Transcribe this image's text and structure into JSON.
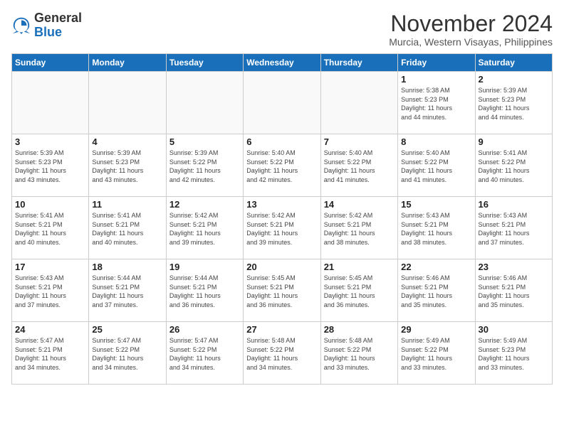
{
  "header": {
    "logo_general": "General",
    "logo_blue": "Blue",
    "month_title": "November 2024",
    "subtitle": "Murcia, Western Visayas, Philippines"
  },
  "weekdays": [
    "Sunday",
    "Monday",
    "Tuesday",
    "Wednesday",
    "Thursday",
    "Friday",
    "Saturday"
  ],
  "weeks": [
    [
      {
        "day": "",
        "info": ""
      },
      {
        "day": "",
        "info": ""
      },
      {
        "day": "",
        "info": ""
      },
      {
        "day": "",
        "info": ""
      },
      {
        "day": "",
        "info": ""
      },
      {
        "day": "1",
        "info": "Sunrise: 5:38 AM\nSunset: 5:23 PM\nDaylight: 11 hours\nand 44 minutes."
      },
      {
        "day": "2",
        "info": "Sunrise: 5:39 AM\nSunset: 5:23 PM\nDaylight: 11 hours\nand 44 minutes."
      }
    ],
    [
      {
        "day": "3",
        "info": "Sunrise: 5:39 AM\nSunset: 5:23 PM\nDaylight: 11 hours\nand 43 minutes."
      },
      {
        "day": "4",
        "info": "Sunrise: 5:39 AM\nSunset: 5:23 PM\nDaylight: 11 hours\nand 43 minutes."
      },
      {
        "day": "5",
        "info": "Sunrise: 5:39 AM\nSunset: 5:22 PM\nDaylight: 11 hours\nand 42 minutes."
      },
      {
        "day": "6",
        "info": "Sunrise: 5:40 AM\nSunset: 5:22 PM\nDaylight: 11 hours\nand 42 minutes."
      },
      {
        "day": "7",
        "info": "Sunrise: 5:40 AM\nSunset: 5:22 PM\nDaylight: 11 hours\nand 41 minutes."
      },
      {
        "day": "8",
        "info": "Sunrise: 5:40 AM\nSunset: 5:22 PM\nDaylight: 11 hours\nand 41 minutes."
      },
      {
        "day": "9",
        "info": "Sunrise: 5:41 AM\nSunset: 5:22 PM\nDaylight: 11 hours\nand 40 minutes."
      }
    ],
    [
      {
        "day": "10",
        "info": "Sunrise: 5:41 AM\nSunset: 5:21 PM\nDaylight: 11 hours\nand 40 minutes."
      },
      {
        "day": "11",
        "info": "Sunrise: 5:41 AM\nSunset: 5:21 PM\nDaylight: 11 hours\nand 40 minutes."
      },
      {
        "day": "12",
        "info": "Sunrise: 5:42 AM\nSunset: 5:21 PM\nDaylight: 11 hours\nand 39 minutes."
      },
      {
        "day": "13",
        "info": "Sunrise: 5:42 AM\nSunset: 5:21 PM\nDaylight: 11 hours\nand 39 minutes."
      },
      {
        "day": "14",
        "info": "Sunrise: 5:42 AM\nSunset: 5:21 PM\nDaylight: 11 hours\nand 38 minutes."
      },
      {
        "day": "15",
        "info": "Sunrise: 5:43 AM\nSunset: 5:21 PM\nDaylight: 11 hours\nand 38 minutes."
      },
      {
        "day": "16",
        "info": "Sunrise: 5:43 AM\nSunset: 5:21 PM\nDaylight: 11 hours\nand 37 minutes."
      }
    ],
    [
      {
        "day": "17",
        "info": "Sunrise: 5:43 AM\nSunset: 5:21 PM\nDaylight: 11 hours\nand 37 minutes."
      },
      {
        "day": "18",
        "info": "Sunrise: 5:44 AM\nSunset: 5:21 PM\nDaylight: 11 hours\nand 37 minutes."
      },
      {
        "day": "19",
        "info": "Sunrise: 5:44 AM\nSunset: 5:21 PM\nDaylight: 11 hours\nand 36 minutes."
      },
      {
        "day": "20",
        "info": "Sunrise: 5:45 AM\nSunset: 5:21 PM\nDaylight: 11 hours\nand 36 minutes."
      },
      {
        "day": "21",
        "info": "Sunrise: 5:45 AM\nSunset: 5:21 PM\nDaylight: 11 hours\nand 36 minutes."
      },
      {
        "day": "22",
        "info": "Sunrise: 5:46 AM\nSunset: 5:21 PM\nDaylight: 11 hours\nand 35 minutes."
      },
      {
        "day": "23",
        "info": "Sunrise: 5:46 AM\nSunset: 5:21 PM\nDaylight: 11 hours\nand 35 minutes."
      }
    ],
    [
      {
        "day": "24",
        "info": "Sunrise: 5:47 AM\nSunset: 5:21 PM\nDaylight: 11 hours\nand 34 minutes."
      },
      {
        "day": "25",
        "info": "Sunrise: 5:47 AM\nSunset: 5:22 PM\nDaylight: 11 hours\nand 34 minutes."
      },
      {
        "day": "26",
        "info": "Sunrise: 5:47 AM\nSunset: 5:22 PM\nDaylight: 11 hours\nand 34 minutes."
      },
      {
        "day": "27",
        "info": "Sunrise: 5:48 AM\nSunset: 5:22 PM\nDaylight: 11 hours\nand 34 minutes."
      },
      {
        "day": "28",
        "info": "Sunrise: 5:48 AM\nSunset: 5:22 PM\nDaylight: 11 hours\nand 33 minutes."
      },
      {
        "day": "29",
        "info": "Sunrise: 5:49 AM\nSunset: 5:22 PM\nDaylight: 11 hours\nand 33 minutes."
      },
      {
        "day": "30",
        "info": "Sunrise: 5:49 AM\nSunset: 5:23 PM\nDaylight: 11 hours\nand 33 minutes."
      }
    ]
  ]
}
